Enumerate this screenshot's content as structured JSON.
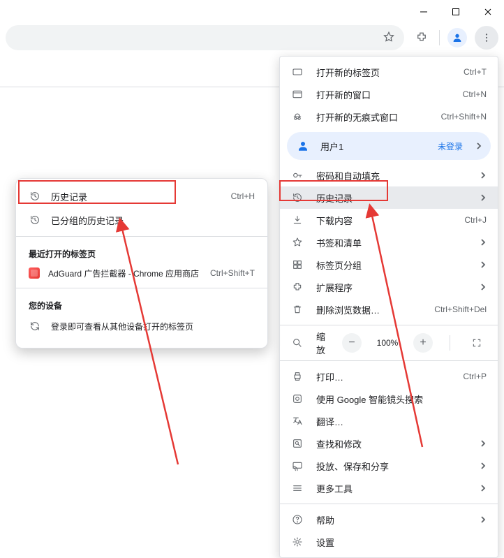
{
  "window": {
    "minimize": "−",
    "maximize": "❐",
    "close": "✕"
  },
  "menu": {
    "new_tab": {
      "label": "打开新的标签页",
      "shortcut": "Ctrl+T"
    },
    "new_window": {
      "label": "打开新的窗口",
      "shortcut": "Ctrl+N"
    },
    "new_incognito": {
      "label": "打开新的无痕式窗口",
      "shortcut": "Ctrl+Shift+N"
    },
    "profile": {
      "label": "用户1",
      "badge": "未登录"
    },
    "passwords": {
      "label": "密码和自动填充"
    },
    "history": {
      "label": "历史记录"
    },
    "downloads": {
      "label": "下载内容",
      "shortcut": "Ctrl+J"
    },
    "bookmarks": {
      "label": "书签和清单"
    },
    "tabgroups": {
      "label": "标签页分组"
    },
    "extensions": {
      "label": "扩展程序"
    },
    "clear_data": {
      "label": "删除浏览数据…",
      "shortcut": "Ctrl+Shift+Del"
    },
    "zoom": {
      "label": "缩放",
      "value": "100%"
    },
    "print": {
      "label": "打印…",
      "shortcut": "Ctrl+P"
    },
    "lens": {
      "label": "使用 Google 智能镜头搜索"
    },
    "translate": {
      "label": "翻译…"
    },
    "find_edit": {
      "label": "查找和修改"
    },
    "cast": {
      "label": "投放、保存和分享"
    },
    "more_tools": {
      "label": "更多工具"
    },
    "help": {
      "label": "帮助"
    },
    "settings": {
      "label": "设置"
    }
  },
  "history_submenu": {
    "history": {
      "label": "历史记录",
      "shortcut": "Ctrl+H"
    },
    "grouped": {
      "label": "已分组的历史记录"
    },
    "recent_heading": "最近打开的标签页",
    "recent_items": [
      {
        "label": "AdGuard 广告拦截器 - Chrome 应用商店",
        "shortcut": "Ctrl+Shift+T"
      }
    ],
    "devices_heading": "您的设备",
    "devices_hint": "登录即可查看从其他设备打开的标签页"
  }
}
